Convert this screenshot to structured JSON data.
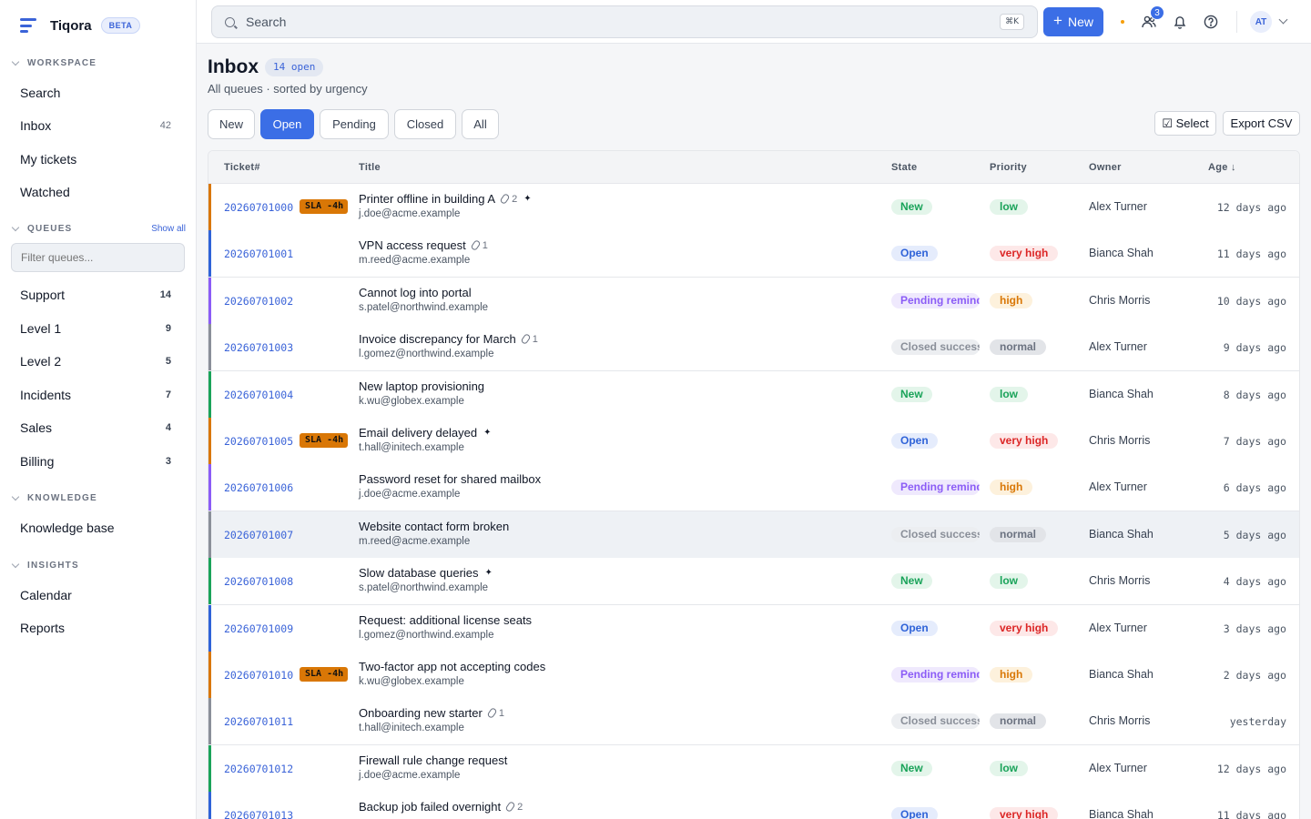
{
  "brand": {
    "name": "Tiqora",
    "badge": "BETA"
  },
  "sidebar": {
    "workspace_label": "WORKSPACE",
    "workspace_items": [
      {
        "label": "Search",
        "count": ""
      },
      {
        "label": "Inbox",
        "count": "42"
      },
      {
        "label": "My tickets",
        "count": ""
      },
      {
        "label": "Watched",
        "count": ""
      }
    ],
    "queues_label": "QUEUES",
    "show_all": "Show all",
    "filter_placeholder": "Filter queues...",
    "queues": [
      {
        "label": "Support",
        "count": "14"
      },
      {
        "label": "Level 1",
        "count": "9"
      },
      {
        "label": "Level 2",
        "count": "5"
      },
      {
        "label": "Incidents",
        "count": "7"
      },
      {
        "label": "Sales",
        "count": "4"
      },
      {
        "label": "Billing",
        "count": "3"
      }
    ],
    "knowledge_label": "KNOWLEDGE",
    "knowledge_items": [
      {
        "label": "Knowledge base"
      }
    ],
    "insights_label": "INSIGHTS",
    "insights_items": [
      {
        "label": "Calendar"
      },
      {
        "label": "Reports"
      }
    ]
  },
  "topbar": {
    "search_placeholder": "Search",
    "shortcut": "⌘K",
    "new_label": "New",
    "team_badge": "3",
    "avatar_initials": "AT"
  },
  "header": {
    "title": "Inbox",
    "open_count": "14 open",
    "subtitle": "All queues · sorted by urgency"
  },
  "tabs": [
    {
      "label": "New",
      "active": false
    },
    {
      "label": "Open",
      "active": true
    },
    {
      "label": "Pending",
      "active": false
    },
    {
      "label": "Closed",
      "active": false
    },
    {
      "label": "All",
      "active": false
    }
  ],
  "toolbar": {
    "select_label": "☑ Select",
    "export_label": "Export CSV"
  },
  "table": {
    "columns": [
      "Ticket#",
      "Title",
      "State",
      "Priority",
      "Owner",
      "Age ↓"
    ],
    "rows": [
      {
        "id": "20260701000",
        "sla": "SLA -4h",
        "title": "Printer offline in building A",
        "attachments": "2",
        "flag": true,
        "email": "j.doe@acme.example",
        "state": "New",
        "priority": "low",
        "owner": "Alex Turner",
        "age": "12 days ago"
      },
      {
        "id": "20260701001",
        "sla": "",
        "title": "VPN access request",
        "attachments": "1",
        "flag": false,
        "email": "m.reed@acme.example",
        "state": "Open",
        "priority": "very high",
        "owner": "Bianca Shah",
        "age": "11 days ago"
      },
      {
        "id": "20260701002",
        "sla": "",
        "title": "Cannot log into portal",
        "attachments": "",
        "flag": false,
        "email": "s.patel@northwind.example",
        "state": "Pending reminder",
        "priority": "high",
        "owner": "Chris Morris",
        "age": "10 days ago"
      },
      {
        "id": "20260701003",
        "sla": "",
        "title": "Invoice discrepancy for March",
        "attachments": "1",
        "flag": false,
        "email": "l.gomez@northwind.example",
        "state": "Closed successful",
        "priority": "normal",
        "owner": "Alex Turner",
        "age": "9 days ago"
      },
      {
        "id": "20260701004",
        "sla": "",
        "title": "New laptop provisioning",
        "attachments": "",
        "flag": false,
        "email": "k.wu@globex.example",
        "state": "New",
        "priority": "low",
        "owner": "Bianca Shah",
        "age": "8 days ago"
      },
      {
        "id": "20260701005",
        "sla": "SLA -4h",
        "title": "Email delivery delayed",
        "attachments": "",
        "flag": true,
        "email": "t.hall@initech.example",
        "state": "Open",
        "priority": "very high",
        "owner": "Chris Morris",
        "age": "7 days ago"
      },
      {
        "id": "20260701006",
        "sla": "",
        "title": "Password reset for shared mailbox",
        "attachments": "",
        "flag": false,
        "email": "j.doe@acme.example",
        "state": "Pending reminder",
        "priority": "high",
        "owner": "Alex Turner",
        "age": "6 days ago"
      },
      {
        "id": "20260701007",
        "sla": "",
        "title": "Website contact form broken",
        "attachments": "",
        "flag": false,
        "email": "m.reed@acme.example",
        "state": "Closed successful",
        "priority": "normal",
        "owner": "Bianca Shah",
        "age": "5 days ago"
      },
      {
        "id": "20260701008",
        "sla": "",
        "title": "Slow database queries",
        "attachments": "",
        "flag": true,
        "email": "s.patel@northwind.example",
        "state": "New",
        "priority": "low",
        "owner": "Chris Morris",
        "age": "4 days ago"
      },
      {
        "id": "20260701009",
        "sla": "",
        "title": "Request: additional license seats",
        "attachments": "",
        "flag": false,
        "email": "l.gomez@northwind.example",
        "state": "Open",
        "priority": "very high",
        "owner": "Alex Turner",
        "age": "3 days ago"
      },
      {
        "id": "20260701010",
        "sla": "SLA -4h",
        "title": "Two-factor app not accepting codes",
        "attachments": "",
        "flag": false,
        "email": "k.wu@globex.example",
        "state": "Pending reminder",
        "priority": "high",
        "owner": "Bianca Shah",
        "age": "2 days ago"
      },
      {
        "id": "20260701011",
        "sla": "",
        "title": "Onboarding new starter",
        "attachments": "1",
        "flag": false,
        "email": "t.hall@initech.example",
        "state": "Closed successful",
        "priority": "normal",
        "owner": "Chris Morris",
        "age": "yesterday"
      },
      {
        "id": "20260701012",
        "sla": "",
        "title": "Firewall rule change request",
        "attachments": "",
        "flag": false,
        "email": "j.doe@acme.example",
        "state": "New",
        "priority": "low",
        "owner": "Alex Turner",
        "age": "12 days ago"
      },
      {
        "id": "20260701013",
        "sla": "",
        "title": "Backup job failed overnight",
        "attachments": "2",
        "flag": false,
        "email": "",
        "state": "Open",
        "priority": "very high",
        "owner": "Bianca Shah",
        "age": "11 days ago"
      }
    ]
  },
  "colors": {
    "accent": "#3b6ee6",
    "sla": "#d97706",
    "state_new": "#1aa35a",
    "state_open": "#2f63d8",
    "state_pending": "#8b5cf6",
    "state_closed": "#8a8f99",
    "prio_very_high": "#dc2626",
    "prio_high": "#d97706"
  }
}
